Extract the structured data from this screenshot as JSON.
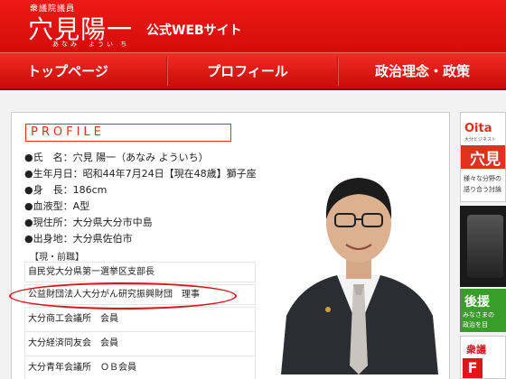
{
  "header": {
    "role": "衆議院議員",
    "name": "穴見陽一",
    "furigana": "あなみ　ようい ち",
    "site_name": "公式WEBサイト"
  },
  "nav": {
    "items": [
      {
        "label": "トップページ"
      },
      {
        "label": "プロフィール"
      },
      {
        "label": "政治理念・政策"
      }
    ]
  },
  "profile": {
    "title": "PROFILE",
    "info": [
      "●氏　名：穴見 陽一（あなみ よういち）",
      "●生年月日：昭和44年7月24日【現在48歳】獅子座",
      "●身　長：186cm",
      "●血液型：A型",
      "●現住所：大分県大分市中島",
      "●出身地：大分県佐伯市"
    ],
    "career_label": "【現・前職】",
    "career": [
      "自民党大分県第一選挙区支部長",
      "公益財団法人大分がん研究振興財団　理事",
      "大分商工会議所　会員",
      "大分経済同友会　会員",
      "大分青年会議所　ＯＢ会員"
    ]
  },
  "sidebar": {
    "banner1_logo": "Oita",
    "banner1_sub": "大分ビジネスト",
    "banner1_name": "穴見",
    "banner1_text1": "様々な分野の",
    "banner1_text2": "語り合う討論",
    "banner3_title": "後援",
    "banner3_text1": "みなさまの",
    "banner3_text2": "政治を目",
    "banner4_title": "衆議"
  },
  "colors": {
    "header_red": "#e8140f",
    "accent_red": "#e0301e",
    "nav_red": "#d8120d"
  }
}
